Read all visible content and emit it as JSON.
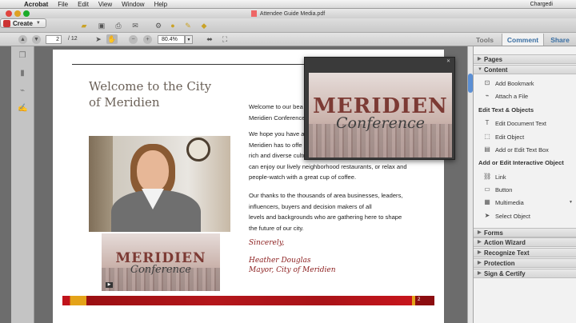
{
  "menubar": {
    "app_name": "Acrobat",
    "menus": [
      "File",
      "Edit",
      "View",
      "Window",
      "Help"
    ],
    "user": "Chargedi"
  },
  "window": {
    "title": "Attendee Guide Media.pdf"
  },
  "toolbar": {
    "create_label": "Create",
    "icons": [
      "open-folder-icon",
      "save-icon",
      "print-icon",
      "email-icon",
      "gear-icon",
      "comment-bubble-icon",
      "sign-icon",
      "share-icon"
    ]
  },
  "nav": {
    "current_page": "2",
    "total_pages": "/ 12",
    "zoom": "80.4%",
    "tabs": {
      "tools": "Tools",
      "comment": "Comment",
      "share": "Share"
    }
  },
  "document": {
    "welcome_line1": "Welcome to the City",
    "welcome_line2": "of Meridien",
    "para1": [
      "Welcome to our bea",
      "Meridien Conference"
    ],
    "para2": [
      "We hope you have a",
      "Meridien has to offe",
      "rich and diverse cultu",
      "can enjoy our lively neighborhood restaurants, or relax and",
      "people-watch with a great cup of  coffee."
    ],
    "para3": [
      "Our thanks to the thousands of area businesses, leaders,",
      "influencers, buyers and decision makers of all",
      "levels and backgrounds who are gathering here to shape",
      "the future of our city."
    ],
    "sincerely": "Sincerely,",
    "sig_name": "Heather Douglas",
    "sig_title": "Mayor, City of Meridien",
    "page_number": "2",
    "media_title": "MERIDIEN",
    "media_subtitle": "Conference"
  },
  "rightpane": {
    "pages": "Pages",
    "content": "Content",
    "add_bookmark": "Add Bookmark",
    "attach_file": "Attach a File",
    "edit_text_objects": "Edit Text & Objects",
    "edit_document_text": "Edit Document Text",
    "edit_object": "Edit Object",
    "add_edit_text_box": "Add or Edit Text Box",
    "add_edit_interactive": "Add or Edit Interactive Object",
    "link": "Link",
    "button": "Button",
    "multimedia": "Multimedia",
    "select_object": "Select Object",
    "forms": "Forms",
    "action_wizard": "Action Wizard",
    "recognize_text": "Recognize Text",
    "protection": "Protection",
    "sign_certify": "Sign & Certify"
  }
}
